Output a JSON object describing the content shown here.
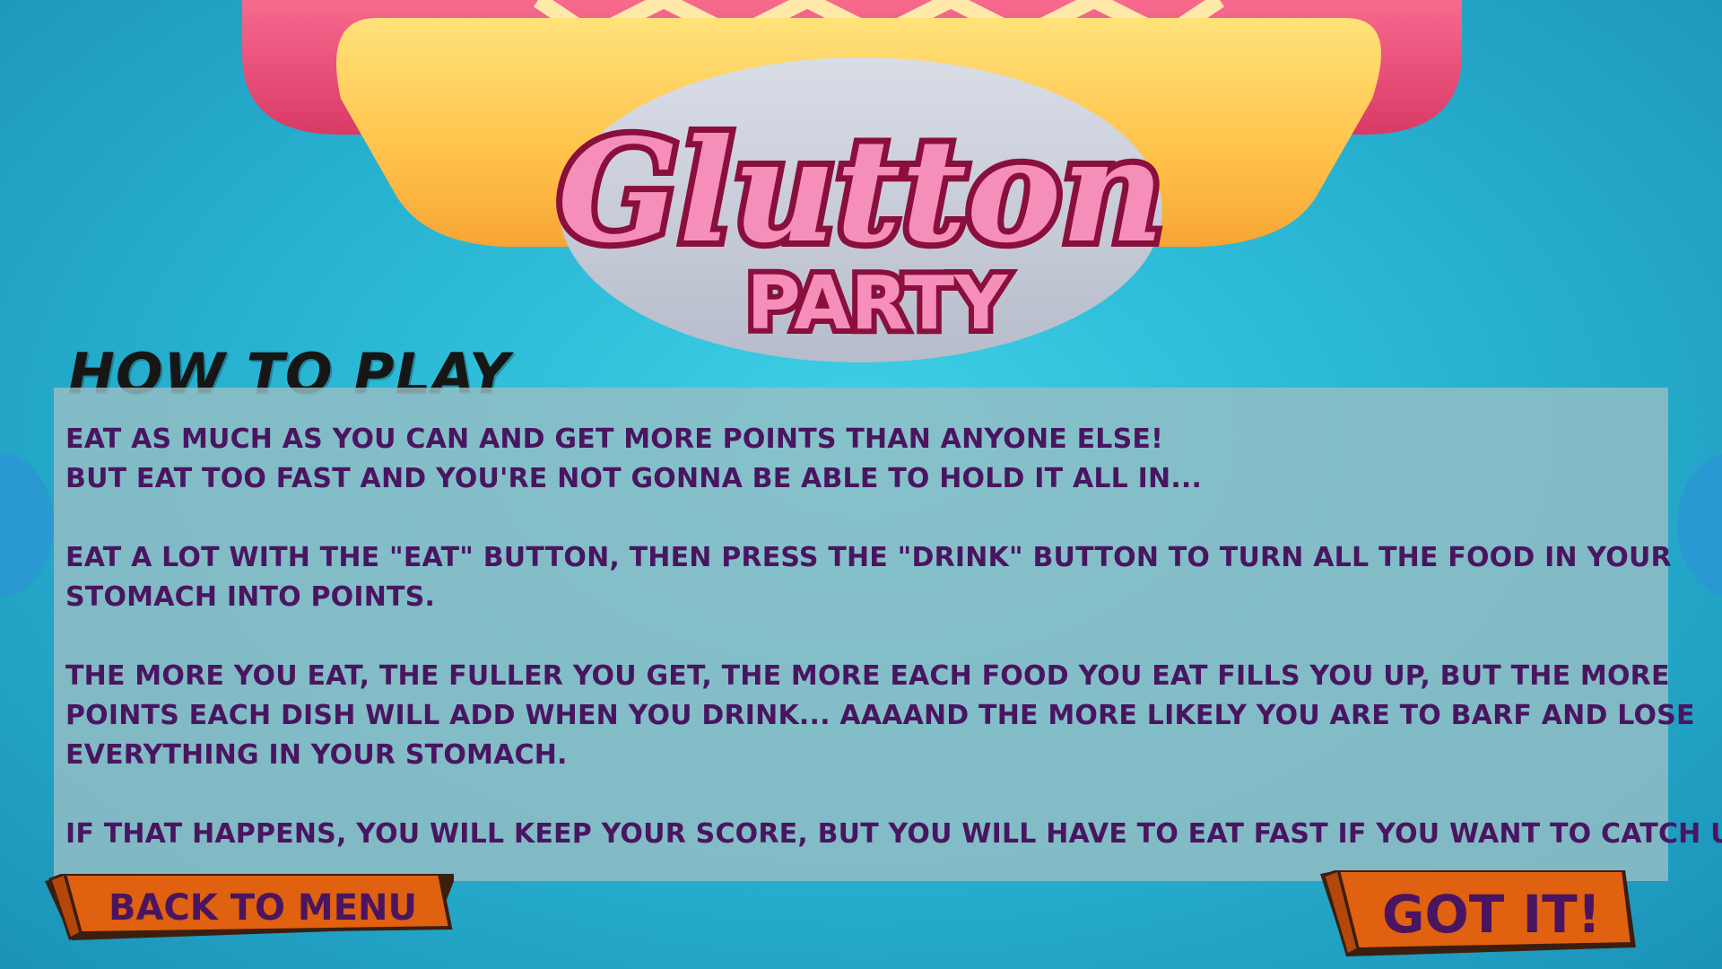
{
  "logo": {
    "title": "Glutton",
    "subtitle": "PARTY"
  },
  "instructions": {
    "heading": "HOW TO PLAY",
    "paragraphs": [
      {
        "lines": [
          "EAT AS MUCH AS YOU CAN AND GET MORE POINTS THAN ANYONE ELSE!",
          "BUT EAT TOO FAST AND YOU'RE NOT GONNA BE ABLE TO HOLD IT ALL IN..."
        ]
      },
      {
        "lines": [
          "EAT A LOT WITH THE \"EAT\" BUTTON, THEN PRESS THE \"DRINK\" BUTTON TO TURN ALL THE FOOD IN YOUR",
          "STOMACH INTO POINTS."
        ]
      },
      {
        "lines": [
          "THE MORE YOU EAT, THE FULLER YOU GET, THE MORE EACH FOOD YOU EAT FILLS YOU UP, BUT THE MORE",
          "POINTS EACH DISH WILL ADD WHEN YOU DRINK... AAAAND THE MORE LIKELY YOU ARE TO BARF AND LOSE",
          "EVERYTHING IN YOUR STOMACH."
        ]
      },
      {
        "lines": [
          "IF THAT HAPPENS, YOU WILL KEEP YOUR SCORE, BUT YOU WILL HAVE TO EAT FAST IF YOU WANT TO CATCH UP!"
        ]
      }
    ]
  },
  "buttons": {
    "back_label": "BACK TO MENU",
    "got_it_label": "GOT IT!"
  },
  "colors": {
    "background": "#2bb9d6",
    "panel": "#96bec4",
    "text": "#4a1560",
    "button_fill": "#e0610f",
    "logo_text": "#f58fb9",
    "logo_outline": "#8a0f3c"
  },
  "icons": {
    "hotdog": "hotdog-illustration"
  }
}
